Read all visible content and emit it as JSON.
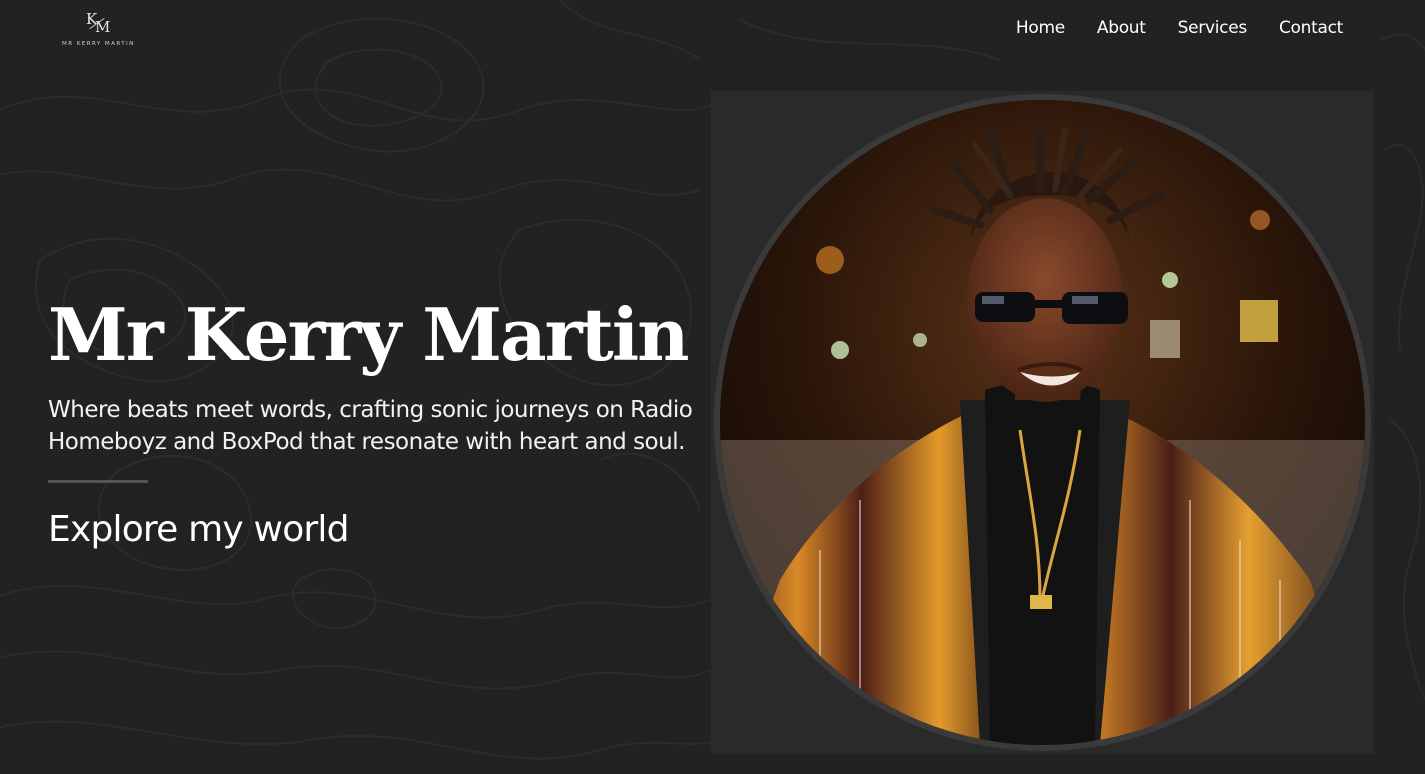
{
  "brand": {
    "logo_initial_k": "K",
    "logo_initial_m": "M",
    "logo_text": "MR KERRY MARTIN"
  },
  "nav": {
    "items": [
      {
        "label": "Home"
      },
      {
        "label": "About"
      },
      {
        "label": "Services"
      },
      {
        "label": "Contact"
      }
    ]
  },
  "hero": {
    "title": "Mr Kerry Martin",
    "subtitle": "Where beats meet words, crafting sonic journeys on Radio Homeboyz and BoxPod that resonate with heart and soul.",
    "cta_label": "Explore my world"
  },
  "colors": {
    "background": "#222222",
    "text": "#ffffff",
    "divider": "#555555",
    "panel": "#2a2a2a"
  },
  "icons": {
    "logo": "km-monogram-logo"
  }
}
